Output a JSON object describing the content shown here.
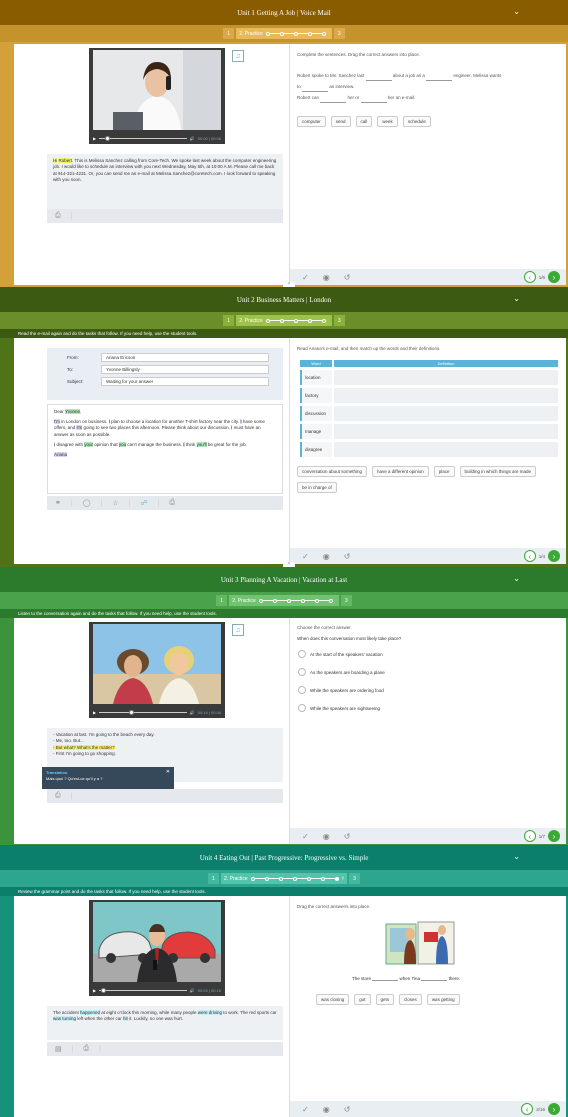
{
  "colors": {
    "unit1_header": "#8a5c00",
    "unit1_bar": "#c5932b",
    "unit1_bg": "#d3a03a",
    "unit2_header": "#3d5a12",
    "unit2_bar": "#6a8f2a",
    "unit2_bg": "#4f7418",
    "unit3_header": "#2c7a2c",
    "unit3_bar": "#4aa24a",
    "unit3_bg": "#3b943b",
    "unit4_header": "#0b7f6c",
    "unit4_bar": "#2ea58e",
    "unit4_bg": "#16917c",
    "nav_green": "#3aaa35"
  },
  "icons": {
    "note": "music-note-icon",
    "volume": "volume-icon",
    "play": "play-icon",
    "print": "printer-icon",
    "check": "check-circle-icon",
    "eye": "eye-icon",
    "undo": "undo-icon",
    "prev": "chevron-left-icon",
    "next": "chevron-right-icon"
  },
  "units": [
    {
      "title": "Unit 1 Getting A Job | Voice Mail",
      "step1": "1",
      "step2": "2. Practice",
      "step3": "3",
      "media_time": "00:00 | 00:36",
      "transcript": {
        "hi": "Hi",
        "name": "Robert",
        "rest": ". This is Melissa Sanchez calling from Core-Tech. We spoke last week about the computer engineering job. I would like to schedule an interview with you next Wednesday, May 5th, at 10:00 A.M. Please call me back at 914-321-4231. Or, you can send me an e-mail at Melissa.Sanchez@coretech.com. I look forward to speaking with you soon."
      },
      "instruction": "Complete the sentences. Drag the correct answers into place.",
      "s1a": "Robert spoke to Ms. Sanchez last",
      "s1b": "about a job as a",
      "s1c": "engineer. Melissa wants",
      "s2a": "to",
      "s2b": "an interview.",
      "s3a": "Robert can",
      "s3b": "her or",
      "s3c": "her an e-mail.",
      "chips": [
        "computer",
        "send",
        "call",
        "week",
        "schedule"
      ],
      "page": "1/6"
    },
    {
      "title": "Unit 2 Business Matters | London",
      "step1": "1",
      "step2": "2. Practice",
      "step3": "3",
      "instruction_bar": "Read the e-mail again and do the tasks that follow. If you need help, use the student tools.",
      "from_label": "From:",
      "from_value": "Ariana Ericson",
      "to_label": "To:",
      "to_value": "Yvonne Billingsly",
      "subject_label": "Subject:",
      "subject_value": "Waiting for your answer",
      "greeting": "Dear",
      "greeting_name": "Yvonne",
      "p1_im": "I'm",
      "p1a": " in London on business. ",
      "p1_i": "I",
      "p1b": " plan to choose a location for another T-shirt factory near the city. ",
      "p1_i2": "I",
      "p1c": " have some offers, and ",
      "p1_im2": "I'm",
      "p1d": " going to see two places this afternoon. Please think about our discussion. ",
      "p1_i3": "I",
      "p1e": " must have an answer as soon as possible.",
      "p2_i": "I",
      "p2a": " disagree with ",
      "p2_your": "your",
      "p2b": " opinion that ",
      "p2_you": "you",
      "p2c": " can't manage the business. ",
      "p2_i2": "I",
      "p2d": " think ",
      "p2_youll": "you'll",
      "p2e": " be great for the job.",
      "signature": "Ariana",
      "instruction": "Read Ariana's e-mail, and then match up the words and their definitions.",
      "col_word": "Word",
      "col_def": "Definition",
      "words": [
        "location",
        "factory",
        "discussion",
        "manage",
        "disagree"
      ],
      "chips": [
        "conversation about something",
        "have a different opinion",
        "place",
        "building in which things are made",
        "be in charge of"
      ],
      "page": "1/4"
    },
    {
      "title": "Unit 3 Planning A Vacation | Vacation at Last",
      "step1": "1",
      "step2": "2. Practice",
      "step3": "3",
      "instruction_bar": "Listen to the conversation again and do the tasks that follow. If you need help, use the student tools.",
      "media_time": "00:14 | 00:34",
      "lines": [
        "- Vacation at last. I'm going to the beach every day.",
        "- Me, too. But...",
        "- But what? What's the matter?",
        "- First I'm going to go shopping."
      ],
      "translation_title": "Translation",
      "translation_text": "Mais quoi ? Qu'est-ce qu'il y a ?",
      "instruction": "Choose the correct answer.",
      "question": "When does this conversation most likely take place?",
      "options": [
        "At the start of the speakers' vacation",
        "As the speakers are boarding a plane",
        "While the speakers are ordering food",
        "While the speakers are sightseeing"
      ],
      "page": "1/7"
    },
    {
      "title": "Unit 4 Eating Out | Past Progressive: Progressive vs. Simple",
      "step1": "1",
      "step2": "2. Practice",
      "step3": "3",
      "instruction_bar": "Review the grammar point and do the tasks that follow. If you need help, use the student tools.",
      "media_time": "00:03 | 00:16",
      "t_a": "The accident ",
      "t_happened": "happened",
      "t_b": " at eight o'clock this morning, while many people ",
      "t_were_driving": "were driving",
      "t_c": " to work. The red sports car ",
      "t_was_turning": "was turning",
      "t_d": " left when the other car ",
      "t_hit": "hit",
      "t_e": " it. Luckily, no one was hurt.",
      "instruction": "Drag the correct answer/s into place.",
      "s1a": "The store",
      "s1b": "when Tina",
      "s1c": "there.",
      "chips": [
        "was closing",
        "got",
        "gets",
        "closes",
        "was getting"
      ],
      "page": "2/16"
    }
  ]
}
